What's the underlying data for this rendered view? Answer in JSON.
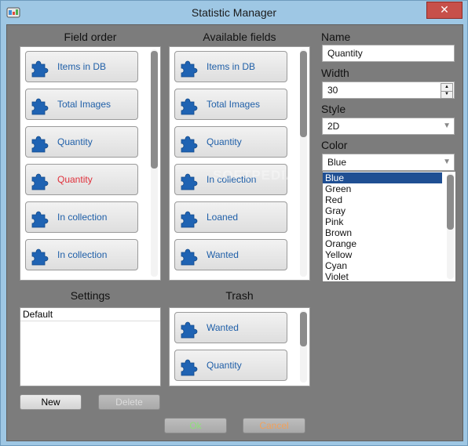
{
  "window": {
    "title": "Statistic Manager",
    "close_glyph": "✕"
  },
  "field_order": {
    "heading": "Field order",
    "items": [
      {
        "label": "Items in DB",
        "highlight": false
      },
      {
        "label": "Total Images",
        "highlight": false
      },
      {
        "label": "Quantity",
        "highlight": false
      },
      {
        "label": "Quantity",
        "highlight": true
      },
      {
        "label": "In collection",
        "highlight": false
      },
      {
        "label": "In collection",
        "highlight": false
      }
    ]
  },
  "available_fields": {
    "heading": "Available fields",
    "items": [
      {
        "label": "Items in DB"
      },
      {
        "label": "Total Images"
      },
      {
        "label": "Quantity"
      },
      {
        "label": "In collection"
      },
      {
        "label": "Loaned"
      },
      {
        "label": "Wanted"
      }
    ]
  },
  "settings": {
    "heading": "Settings",
    "items": [
      "Default"
    ],
    "new_label": "New",
    "delete_label": "Delete"
  },
  "trash": {
    "heading": "Trash",
    "items": [
      {
        "label": "Wanted"
      },
      {
        "label": "Quantity"
      }
    ]
  },
  "props": {
    "name_label": "Name",
    "name_value": "Quantity",
    "width_label": "Width",
    "width_value": "30",
    "style_label": "Style",
    "style_value": "2D",
    "color_label": "Color",
    "color_value": "Blue",
    "color_options": [
      "Blue",
      "Green",
      "Red",
      "Gray",
      "Pink",
      "Brown",
      "Orange",
      "Yellow",
      "Cyan",
      "Violet"
    ],
    "color_selected": "Blue"
  },
  "footer": {
    "ok_label": "Ok",
    "cancel_label": "Cancel"
  },
  "watermark": "SOFTPEDIA",
  "colors": {
    "link_blue": "#1f5fa8",
    "highlight_red": "#e0303b",
    "puzzle_blue": "#1f63b3",
    "ok_text": "#8ee07a",
    "cancel_text": "#f2a15a"
  },
  "icons": [
    "app-icon",
    "close-icon",
    "puzzle-icon",
    "spin-up-icon",
    "spin-down-icon",
    "dropdown-arrow-icon"
  ]
}
